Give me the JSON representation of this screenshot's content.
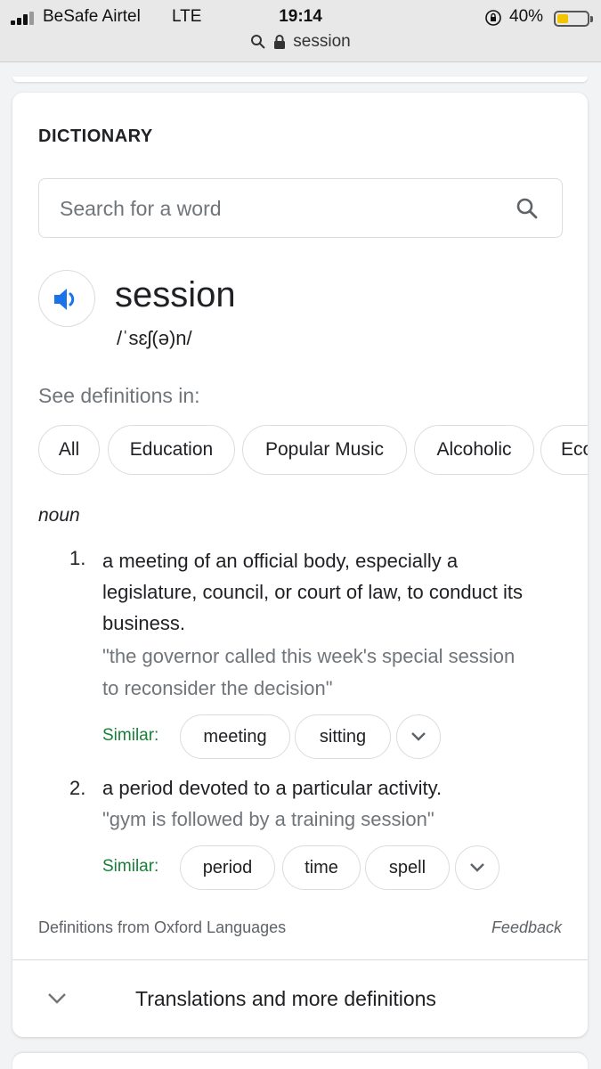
{
  "status_bar": {
    "carrier": "BeSafe Airtel",
    "network": "LTE",
    "time": "19:14",
    "battery_percent": "40%",
    "battery_level": 0.4,
    "url": "session"
  },
  "dictionary": {
    "heading": "DICTIONARY",
    "search_placeholder": "Search for a word",
    "word": "session",
    "phonetic": "/ˈsɛʃ(ə)n/",
    "see_definitions_label": "See definitions in:",
    "categories": [
      "All",
      "Education",
      "Popular Music",
      "Alcoholic",
      "Eco"
    ],
    "part_of_speech": "noun",
    "definitions": [
      {
        "number": "1.",
        "text": "a meeting of an official body, especially a legislature, council, or court of law, to conduct its business.",
        "example": "\"the governor called this week's special session to reconsider the decision\"",
        "similar_label": "Similar:",
        "similar": [
          "meeting",
          "sitting"
        ]
      },
      {
        "number": "2.",
        "text": "a period devoted to a particular activity.",
        "example": "\"gym is followed by a training session\"",
        "similar_label": "Similar:",
        "similar": [
          "period",
          "time",
          "spell"
        ]
      }
    ],
    "source": "Definitions from Oxford Languages",
    "feedback": "Feedback",
    "more_label": "Translations and more definitions"
  },
  "colors": {
    "similar_green": "#188038",
    "speaker_blue": "#1a73e8",
    "battery_yellow": "#f4c400"
  }
}
